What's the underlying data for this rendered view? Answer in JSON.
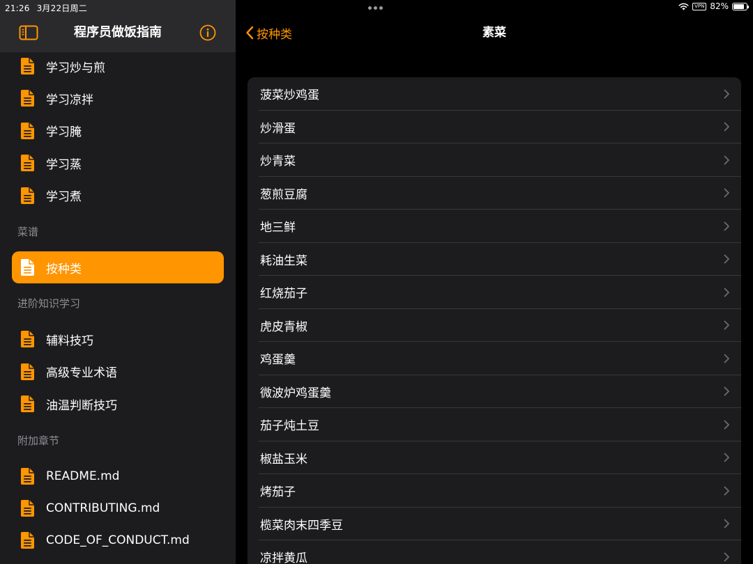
{
  "status": {
    "time": "21:26",
    "date": "3月22日周二",
    "vpn": "VPN",
    "battery": "82%",
    "battery_level": 0.82
  },
  "sidebar": {
    "title": "程序员做饭指南",
    "groups": [
      {
        "header": "",
        "items": [
          {
            "label": "学习炒与煎",
            "active": false
          },
          {
            "label": "学习凉拌",
            "active": false
          },
          {
            "label": "学习腌",
            "active": false
          },
          {
            "label": "学习蒸",
            "active": false
          },
          {
            "label": "学习煮",
            "active": false
          }
        ]
      },
      {
        "header": "菜谱",
        "items": [
          {
            "label": "按种类",
            "active": true
          }
        ]
      },
      {
        "header": "进阶知识学习",
        "items": [
          {
            "label": "辅料技巧",
            "active": false
          },
          {
            "label": "高级专业术语",
            "active": false
          },
          {
            "label": "油温判断技巧",
            "active": false
          }
        ]
      },
      {
        "header": "附加章节",
        "items": [
          {
            "label": "README.md",
            "active": false
          },
          {
            "label": "CONTRIBUTING.md",
            "active": false
          },
          {
            "label": "CODE_OF_CONDUCT.md",
            "active": false
          }
        ]
      }
    ]
  },
  "nav": {
    "back_label": "按种类",
    "title": "素菜"
  },
  "recipes": [
    "菠菜炒鸡蛋",
    "炒滑蛋",
    "炒青菜",
    "葱煎豆腐",
    "地三鲜",
    "耗油生菜",
    "红烧茄子",
    "虎皮青椒",
    "鸡蛋羹",
    "微波炉鸡蛋羹",
    "茄子炖土豆",
    "椒盐玉米",
    "烤茄子",
    "榄菜肉末四季豆",
    "凉拌黄瓜"
  ],
  "colors": {
    "accent": "#ff9500",
    "sidebar_bg": "#1c1c1e",
    "header_bg": "#2a2a2c",
    "card_bg": "#1c1c1e",
    "separator": "#38383a",
    "secondary_text": "#8e8e93",
    "chevron": "#6c6c70"
  },
  "icons": {
    "sidebar_toggle": "sidebar-toggle-icon",
    "info": "info-icon",
    "document": "document-icon",
    "back": "chevron-left-icon",
    "row_disclosure": "chevron-right-icon",
    "wifi": "wifi-icon",
    "battery": "battery-icon"
  }
}
